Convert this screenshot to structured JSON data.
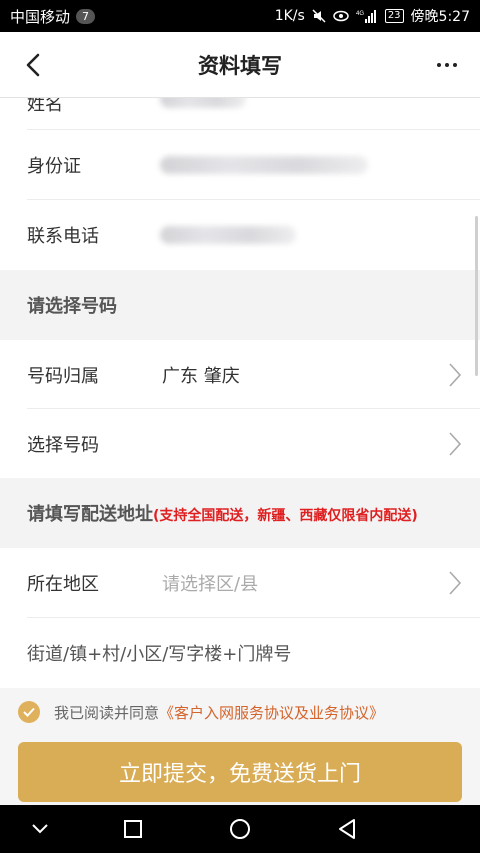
{
  "status_bar": {
    "carrier": "中国移动",
    "notif_count": "7",
    "speed": "1K/s",
    "network": "4G",
    "battery": "23",
    "time": "傍晚5:27"
  },
  "navbar": {
    "title": "资料填写",
    "back_icon": "back-chevron-icon",
    "more_icon": "more-dots-icon"
  },
  "form": {
    "name_label": "姓名",
    "name_value": "",
    "id_label": "身份证",
    "id_value": "",
    "phone_label": "联系电话",
    "phone_value": ""
  },
  "number_section": {
    "title": "请选择号码",
    "region_label": "号码归属",
    "region_value": "广东 肇庆",
    "select_label": "选择号码"
  },
  "address_section": {
    "title": "请填写配送地址",
    "note": "(支持全国配送，新疆、西藏仅限省内配送)",
    "area_label": "所在地区",
    "area_placeholder": "请选择区/县",
    "street_placeholder": "街道/镇+村/小区/写字楼+门牌号"
  },
  "agreement": {
    "prefix": "我已阅读并同意",
    "link": "《客户入网服务协议及业务协议》",
    "checked": true
  },
  "submit_label": "立即提交，免费送货上门",
  "colors": {
    "accent": "#d9ac56",
    "link": "#d4642b",
    "note_red": "#e02020"
  }
}
